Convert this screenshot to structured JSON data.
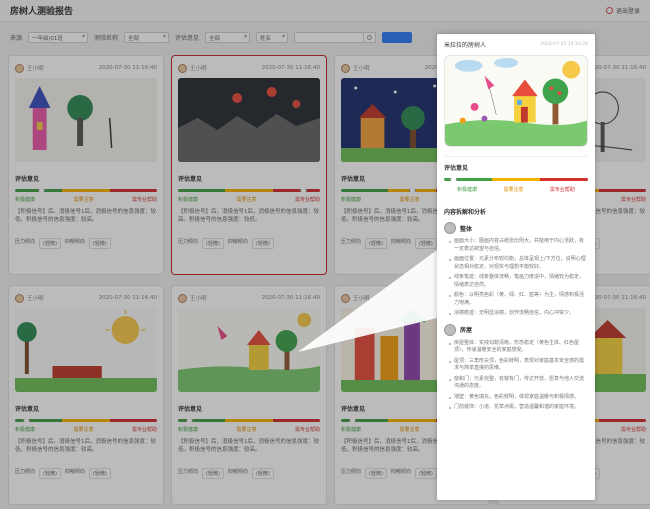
{
  "app": {
    "title": "房树人测验报告",
    "exit_label": "退出登录"
  },
  "filters": {
    "source_label": "来源",
    "source_value": "一年级/01班",
    "test_label": "测验名称",
    "test_value": "全部",
    "eval_label": "评估意见",
    "eval_value": "全部",
    "name_label": "姓名"
  },
  "cards": [
    {
      "name": "王小明",
      "date": "2020-07-30 11:16:40",
      "eval": "评估意见",
      "knob": 0.18,
      "labels": [
        "积极健康",
        "需要注意",
        "需专业帮助"
      ],
      "text": "【积极信号】后。消极信号1后，消极信号的信息强度：较低。积极信号的信息强度：较高。",
      "tags": [
        "压力倾向",
        "(轻微)",
        "抑郁倾向",
        "(轻微)"
      ]
    },
    {
      "name": "王小明",
      "date": "2020-07-30 11:16:40",
      "eval": "评估意见",
      "knob": 0.88,
      "selected": true,
      "labels": [
        "积极健康",
        "需要注意",
        "需专业帮助"
      ],
      "text": "【积极信号】后，消极信号1后，消极信号的信息强度：较高。积极信号的信息强度：较低。",
      "tags": [
        "压力倾向",
        "(轻微)",
        "抑郁倾向",
        "(轻微)"
      ]
    },
    {
      "name": "王小明",
      "date": "2020-07-30 11:16:40",
      "eval": "评估意见",
      "knob": 0.5,
      "labels": [
        "积极健康",
        "需要注意",
        "需专业帮助"
      ],
      "text": "【积极信号】后，消极信号1后，消极信号的信息强度：较低。积极信号的信息强度：较高。",
      "tags": [
        "压力倾向",
        "(轻微)",
        "抑郁倾向",
        "(轻微)"
      ]
    },
    {
      "name": "王小明",
      "date": "2020-07-30 11:16:40",
      "eval": "评估意见",
      "knob": 0.5,
      "labels": [
        "积极健康",
        "需要注意",
        "需专业帮助"
      ],
      "text": "【积极信号】后，消极信号1后，消极信号的信息强度：较低。积极信号的信息强度：较高。",
      "tags": [
        "压力倾向",
        "(中等)",
        "抑郁倾向",
        "(中等)"
      ]
    },
    {
      "name": "王小明",
      "date": "2020-07-30 11:16:40",
      "eval": "评估意见",
      "knob": 0.08,
      "labels": [
        "积极健康",
        "需要注意",
        "需专业帮助"
      ],
      "text": "【积极信号】后。消极信号1后，消极信号的信息强度：较低。积极信号的信息强度：较高。",
      "tags": [
        "压力倾向",
        "(轻微)",
        "抑郁倾向",
        "(轻微)"
      ]
    },
    {
      "name": "王小明",
      "date": "2020-07-30 11:16:40",
      "eval": "评估意见",
      "knob": 0.08,
      "labels": [
        "积极健康",
        "需要注意",
        "需专业帮助"
      ],
      "text": "【积极信号】后，消极信号1后，消极信号的信息强度：较低。积极信号的信息强度：较高。",
      "tags": [
        "压力倾向",
        "(轻微)",
        "抑郁倾向",
        "(轻微)"
      ]
    },
    {
      "name": "王小明",
      "date": "2020-07-30 11:16:40",
      "eval": "评估意见",
      "knob": 0.08,
      "labels": [
        "积极健康",
        "需要注意",
        "需专业帮助"
      ],
      "text": "【积极信号】后，消极信号1后，消极信号的信息强度：较低。积极信号的信息强度：较高。",
      "tags": [
        "压力倾向",
        "(轻微)",
        "抑郁倾向",
        "(轻微)"
      ]
    },
    {
      "name": "王小明",
      "date": "2020-07-30 11:16:40",
      "eval": "评估意见",
      "knob": 0.5,
      "labels": [
        "积极健康",
        "需要注意",
        "需专业帮助"
      ],
      "text": "【积极信号】后，消极信号1后，消极信号的信息强度：较低。积极信号的信息强度：较高。",
      "tags": [
        "压力倾向",
        "(中等)",
        "抑郁倾向",
        "(中等)"
      ]
    }
  ],
  "panel": {
    "name": "米拉拉的房树人",
    "time": "2020-07-25 14:10:28",
    "eval_title": "评估意见",
    "knob": 0.06,
    "labels": [
      "积极健康",
      "需要注意",
      "需专业帮助"
    ],
    "analysis_title": "内容拆解和分析",
    "overall_title": "整体",
    "overall_items": [
      "画面大小：图画内容占纸张比例大，并能用于内心活跃，有一定表达欲望与自信。",
      "画面位置：元素分布较均衡，总体呈现上/下方位，说明心理状态相对稳定，对现实与理想平衡较好。",
      "线条笔迹：线条整体流畅，笔画力度适中，情绪较为稳定，情绪表达自然。",
      "颜色：以明亮色彩（黄、绿、红、蓝等）为主，情感积极活力饱满。",
      "涂擦痕迹：无明显涂擦，创作流畅自信，内心冲突少。"
    ],
    "house_title": "房屋",
    "house_items": [
      "房屋整体：实线勾勒清晰，形态稳定（黄色主体、红色屋顶），传递温暖安全的家庭感受。",
      "屋顶：三角形尖顶，色彩鲜明，表现对家庭基本安全感的需求与简单直接的思维。",
      "窗和门：元素完整，有窗有门，传达开放、愿意与他人交流沟通的态度。",
      "墙壁：黄色填充，色彩鲜明，体现家庭温暖与积极情感。",
      "门前装饰：小道、花草点缀，营造温馨和谐的家庭环境。"
    ]
  }
}
